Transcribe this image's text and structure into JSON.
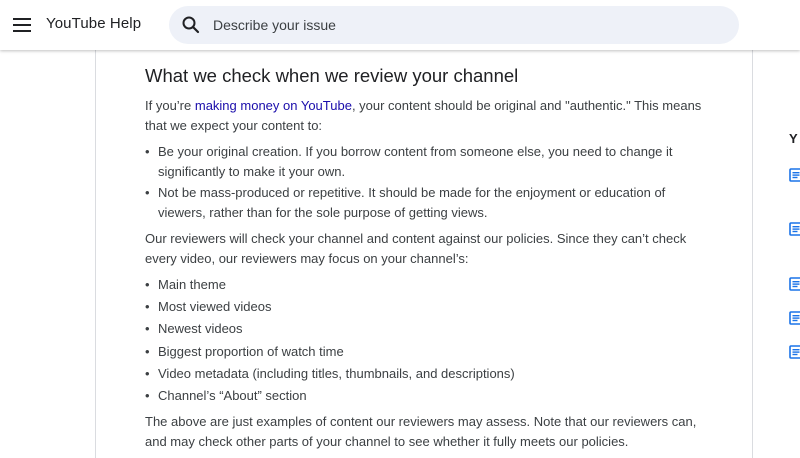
{
  "header": {
    "product_name": "YouTube Help",
    "search_placeholder": "Describe your issue",
    "menu_icon": "hamburger-menu-icon",
    "search_icon": "search-icon"
  },
  "article": {
    "title": "What we check when we review your channel",
    "intro_prefix": "If you’re ",
    "intro_link": "making money on YouTube",
    "intro_suffix": ", your content should be original and \"authentic.\" This means that we expect your content to:",
    "expectations": [
      "Be your original creation. If you borrow content from someone else, you need to change it significantly to make it your own.",
      "Not be mass-produced or repetitive. It should be made for the enjoyment or education of viewers, rather than for the sole purpose of getting views."
    ],
    "review_intro": "Our reviewers will check your channel and content against our policies. Since they can’t check every video, our reviewers may focus on your channel’s:",
    "focus_items": [
      "Main theme",
      "Most viewed videos",
      "Newest videos",
      "Biggest proportion of watch time",
      "Video metadata (including titles, thumbnails, and descriptions)",
      "Channel’s “About” section"
    ],
    "closing": "The above are just examples of content our reviewers may assess. Note that our reviewers can, and may check other parts of your channel to see whether it fully meets our policies."
  },
  "sidebar": {
    "heading_fragment": "Y",
    "doc_icon": "document-icon"
  },
  "colors": {
    "link": "#1a0dab",
    "search_bg": "#eef1f8",
    "doc_icon": "#1a73e8"
  }
}
